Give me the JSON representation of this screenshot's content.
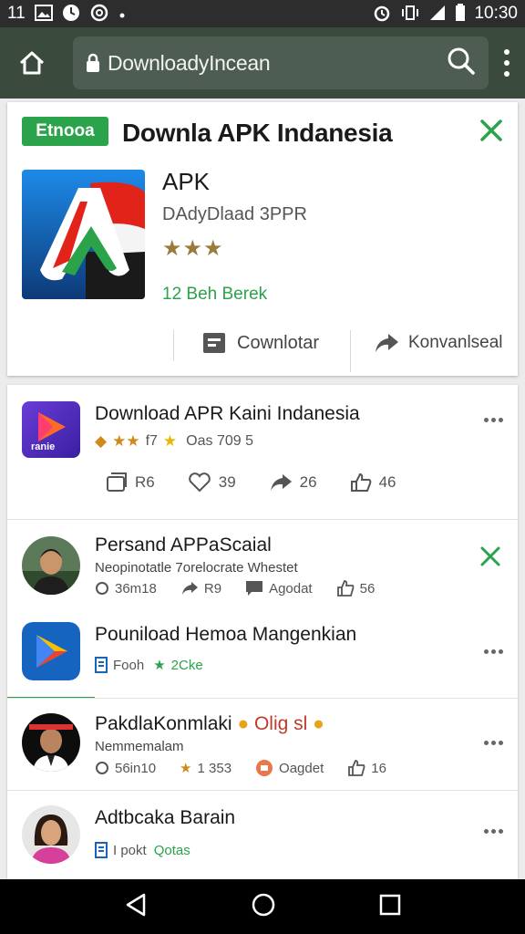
{
  "status_bar": {
    "left_time": "11",
    "right_time": "10:30"
  },
  "browser": {
    "url": "DownloadyIncean"
  },
  "featured": {
    "badge": "Etnooa",
    "title": "Downla APK Indanesia",
    "app_name": "APK",
    "subtitle": "DAdyDlaad 3PPR",
    "rating_stars": 3,
    "status": "12 Beh Berek",
    "download_label": "Cownlotar",
    "share_label": "Konvanlseal",
    "accent_color": "#2aa34a"
  },
  "app_post": {
    "name": "Download APR Kaini Indanesia",
    "rating_text": "f7",
    "meta_text": "Oas 709 5",
    "icon_text": "ranie",
    "actions": [
      {
        "icon": "repost-icon",
        "count": "R6"
      },
      {
        "icon": "heart-icon",
        "count": "39"
      },
      {
        "icon": "share-icon",
        "count": "26"
      },
      {
        "icon": "thumbs-up-icon",
        "count": "46"
      }
    ]
  },
  "feed": [
    {
      "name": "Persand APPaScaial",
      "subtitle": "Neopinotatle 7orelocrate Whestet",
      "stats": [
        "36m18",
        "R9",
        "Agodat",
        "56"
      ],
      "trailing": "close"
    },
    {
      "name": "Pouniload Hemoa Mangenkian",
      "tag_icon": "bookmark-icon",
      "tag_label": "Fooh",
      "tag_status": "2Cke",
      "trailing": "more"
    },
    {
      "name": "PakdlaKonmlaki",
      "emoji_label": "Olig sl",
      "subtitle": "Nemmemalam",
      "stats": [
        "56in10",
        "1 353",
        "Oagdet",
        "16"
      ],
      "trailing": "more"
    },
    {
      "name": "Adtbcaka Barain",
      "tag_icon": "bookmark-icon",
      "tag_label": "I pokt",
      "tag_status": "Qotas",
      "trailing": "more"
    }
  ]
}
